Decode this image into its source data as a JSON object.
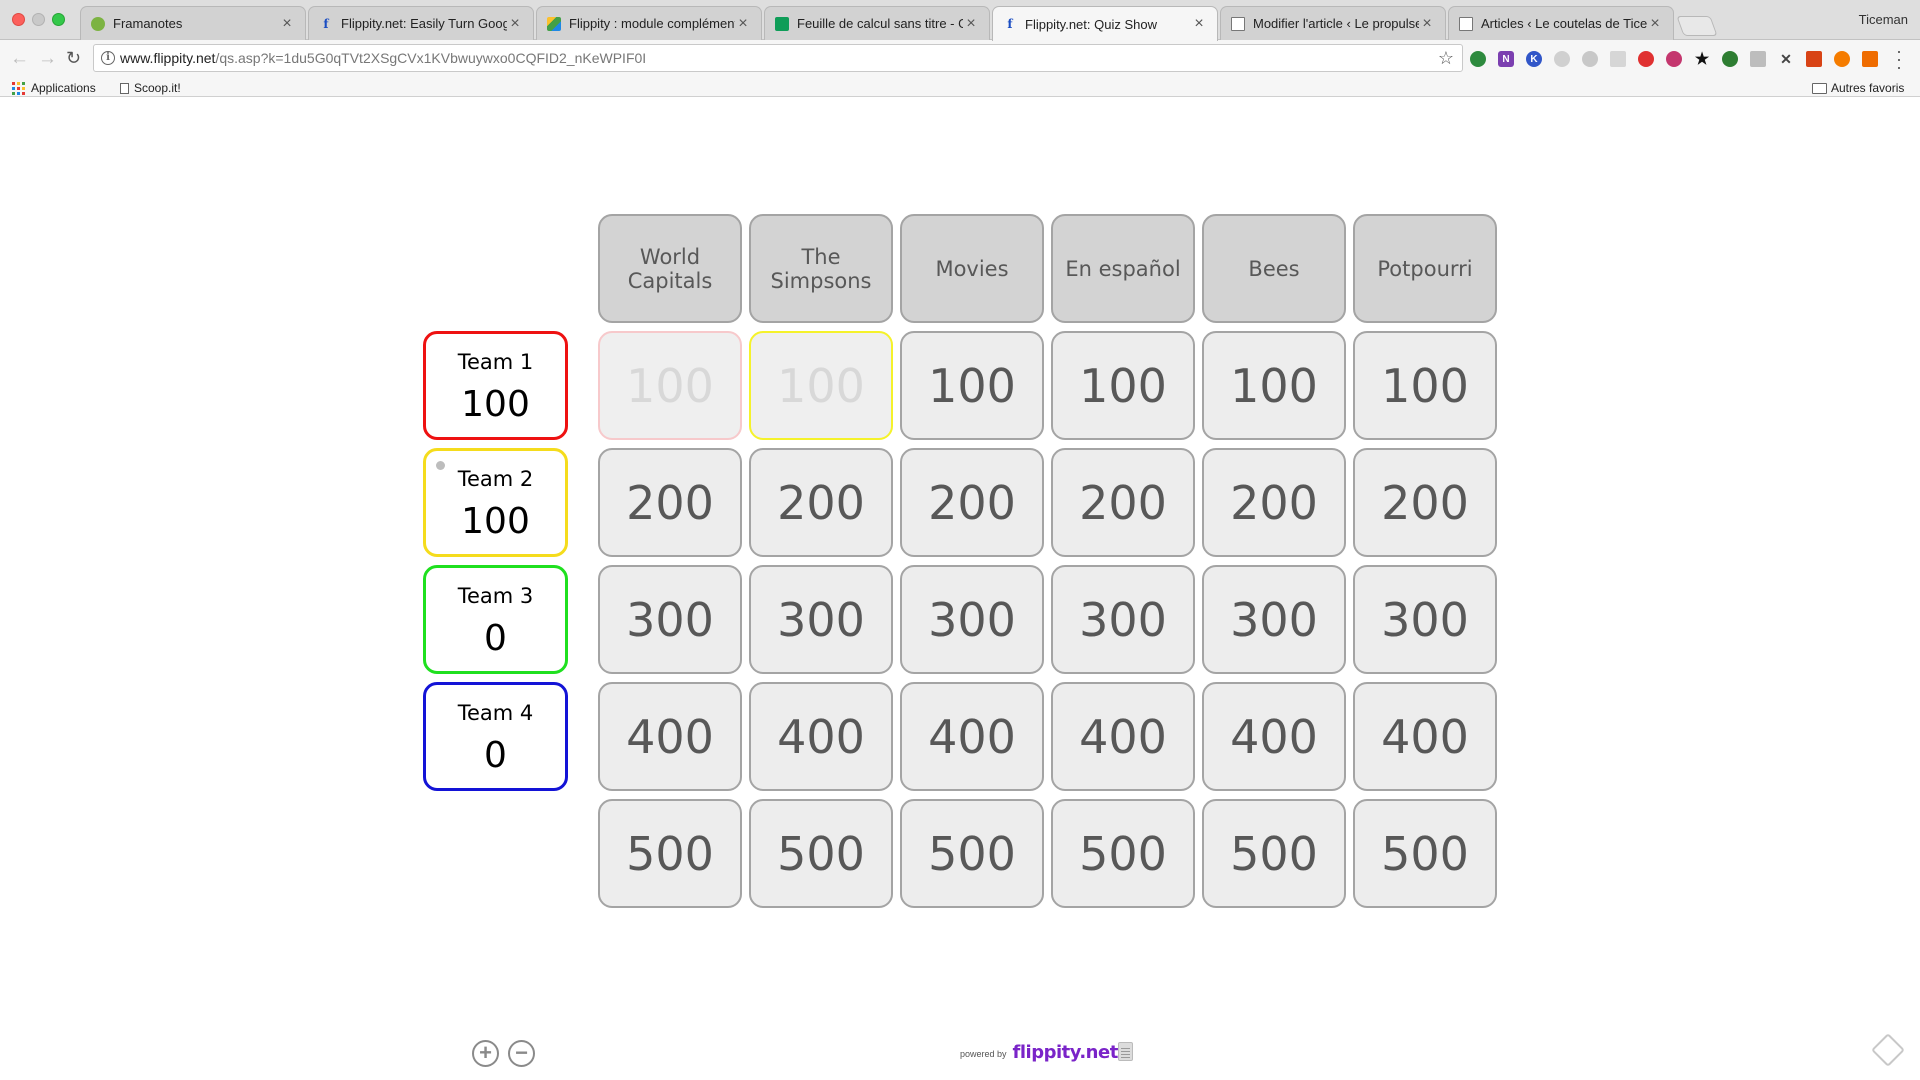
{
  "browser": {
    "profile": "Ticeman",
    "tabs": [
      {
        "title": "Framanotes",
        "favicon": "framanotes-icon",
        "active": false
      },
      {
        "title": "Flippity.net: Easily Turn Google",
        "favicon": "flippity-icon",
        "active": false
      },
      {
        "title": "Flippity : module complémenta",
        "favicon": "google-drive-icon",
        "active": false
      },
      {
        "title": "Feuille de calcul sans titre - Go",
        "favicon": "google-sheets-icon",
        "active": false
      },
      {
        "title": "Flippity.net: Quiz Show",
        "favicon": "flippity-icon",
        "active": true
      },
      {
        "title": "Modifier l'article ‹ Le propulseu",
        "favicon": "page-icon",
        "active": false
      },
      {
        "title": "Articles ‹ Le coutelas de Ticem",
        "favicon": "page-icon",
        "active": false
      }
    ],
    "url_domain": "www.flippity.net",
    "url_path": "/qs.asp?k=1du5G0qTVt2XSgCVx1KVbwuywxo0CQFID2_nKeWPIF0I",
    "bookmarks": [
      {
        "label": "Applications",
        "icon": "apps-grid-icon"
      },
      {
        "label": "Scoop.it!",
        "icon": "page-icon"
      }
    ],
    "other_bookmarks": "Autres favoris"
  },
  "quiz": {
    "categories": [
      "World Capitals",
      "The Simpsons",
      "Movies",
      "En español",
      "Bees",
      "Potpourri"
    ],
    "rows": [
      {
        "points": [
          "100",
          "100",
          "100",
          "100",
          "100",
          "100"
        ],
        "used": [
          true,
          true,
          false,
          false,
          false,
          false
        ]
      },
      {
        "points": [
          "200",
          "200",
          "200",
          "200",
          "200",
          "200"
        ],
        "used": [
          false,
          false,
          false,
          false,
          false,
          false
        ]
      },
      {
        "points": [
          "300",
          "300",
          "300",
          "300",
          "300",
          "300"
        ],
        "used": [
          false,
          false,
          false,
          false,
          false,
          false
        ]
      },
      {
        "points": [
          "400",
          "400",
          "400",
          "400",
          "400",
          "400"
        ],
        "used": [
          false,
          false,
          false,
          false,
          false,
          false
        ]
      },
      {
        "points": [
          "500",
          "500",
          "500",
          "500",
          "500",
          "500"
        ],
        "used": [
          false,
          false,
          false,
          false,
          false,
          false
        ]
      }
    ],
    "teams": [
      {
        "name": "Team 1",
        "score": "100",
        "color": "#ee1111"
      },
      {
        "name": "Team 2",
        "score": "100",
        "color": "#f5dc1c"
      },
      {
        "name": "Team 3",
        "score": "0",
        "color": "#1fe01f"
      },
      {
        "name": "Team 4",
        "score": "0",
        "color": "#1313d6"
      }
    ],
    "current_team": 2,
    "used_cell_colors": [
      "#f7c9cb",
      "#f5f22a"
    ]
  },
  "footer": {
    "powered_by": "powered by",
    "logo": "flippity.net",
    "zoom_in_icon": "plus-circle-icon",
    "zoom_out_icon": "minus-circle-icon"
  }
}
